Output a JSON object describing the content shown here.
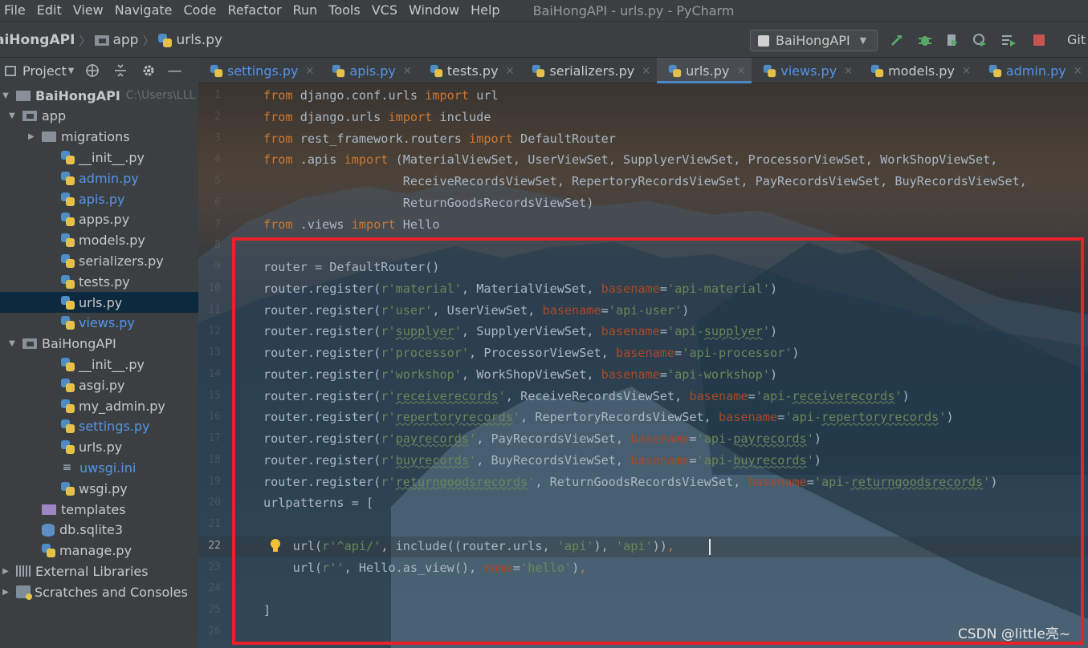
{
  "menu": [
    "File",
    "Edit",
    "View",
    "Navigate",
    "Code",
    "Refactor",
    "Run",
    "Tools",
    "VCS",
    "Window",
    "Help"
  ],
  "window_title": "BaiHongAPI - urls.py - PyCharm",
  "breadcrumb": [
    "aiHongAPI",
    "app",
    "urls.py"
  ],
  "toolbar": {
    "run_config": "BaiHongAPI",
    "git_label": "Git",
    "icons": [
      "hammer-icon",
      "bug-icon",
      "coverage-icon",
      "profile-icon",
      "concurrency-icon",
      "stop-icon"
    ]
  },
  "project_panel": {
    "title": "Project",
    "tree": [
      {
        "label": "BaiHongAPI",
        "hint": "C:\\Users\\LLL",
        "type": "folder",
        "indent": 0,
        "arrow": "down",
        "bold": true
      },
      {
        "label": "app",
        "type": "folder-open",
        "indent": 1,
        "arrow": "down"
      },
      {
        "label": "migrations",
        "type": "folder",
        "indent": 2,
        "arrow": "right"
      },
      {
        "label": "__init__.py",
        "type": "py",
        "indent": 3
      },
      {
        "label": "admin.py",
        "type": "py",
        "indent": 3,
        "blue": true
      },
      {
        "label": "apis.py",
        "type": "py",
        "indent": 3,
        "blue": true
      },
      {
        "label": "apps.py",
        "type": "py",
        "indent": 3
      },
      {
        "label": "models.py",
        "type": "py",
        "indent": 3
      },
      {
        "label": "serializers.py",
        "type": "py",
        "indent": 3
      },
      {
        "label": "tests.py",
        "type": "py",
        "indent": 3
      },
      {
        "label": "urls.py",
        "type": "py",
        "indent": 3,
        "selected": true
      },
      {
        "label": "views.py",
        "type": "py",
        "indent": 3,
        "blue": true
      },
      {
        "label": "BaiHongAPI",
        "type": "folder-open",
        "indent": 1,
        "arrow": "down"
      },
      {
        "label": "__init__.py",
        "type": "py",
        "indent": 3
      },
      {
        "label": "asgi.py",
        "type": "py",
        "indent": 3
      },
      {
        "label": "my_admin.py",
        "type": "py",
        "indent": 3
      },
      {
        "label": "settings.py",
        "type": "py",
        "indent": 3,
        "blue": true
      },
      {
        "label": "urls.py",
        "type": "py",
        "indent": 3
      },
      {
        "label": "uwsgi.ini",
        "type": "ini",
        "indent": 3,
        "blue": true
      },
      {
        "label": "wsgi.py",
        "type": "py",
        "indent": 3
      },
      {
        "label": "templates",
        "type": "folder-purple",
        "indent": 2
      },
      {
        "label": "db.sqlite3",
        "type": "db",
        "indent": 2
      },
      {
        "label": "manage.py",
        "type": "py",
        "indent": 2
      },
      {
        "label": "External Libraries",
        "type": "lib",
        "indent": 0,
        "arrow": "right"
      },
      {
        "label": "Scratches and Consoles",
        "type": "scratch",
        "indent": 0,
        "arrow": "right"
      }
    ]
  },
  "tabs": [
    {
      "label": "settings.py",
      "blue": true
    },
    {
      "label": "apis.py",
      "blue": true
    },
    {
      "label": "tests.py"
    },
    {
      "label": "serializers.py"
    },
    {
      "label": "urls.py",
      "active": true
    },
    {
      "label": "views.py",
      "blue": true
    },
    {
      "label": "models.py"
    },
    {
      "label": "admin.py",
      "blue": true
    }
  ],
  "editor": {
    "current_line": 22,
    "line_numbers": [
      "1",
      "2",
      "3",
      "4",
      "5",
      "6",
      "7",
      "8",
      "9",
      "10",
      "11",
      "12",
      "13",
      "14",
      "15",
      "16",
      "17",
      "18",
      "19",
      "20",
      "21",
      "22",
      "23",
      "24",
      "25",
      "26"
    ],
    "lines": [
      [
        [
          "kw",
          "from "
        ],
        [
          "",
          "django.conf.urls "
        ],
        [
          "kw",
          "import "
        ],
        [
          "",
          "url"
        ]
      ],
      [
        [
          "kw",
          "from "
        ],
        [
          "",
          "django.urls "
        ],
        [
          "kw",
          "import "
        ],
        [
          "",
          "include"
        ]
      ],
      [
        [
          "kw",
          "from "
        ],
        [
          "",
          "rest_framework.routers "
        ],
        [
          "kw",
          "import "
        ],
        [
          "",
          "DefaultRouter"
        ]
      ],
      [
        [
          "kw",
          "from "
        ],
        [
          "",
          ".apis "
        ],
        [
          "kw",
          "import "
        ],
        [
          "",
          "(MaterialViewSet, UserViewSet, SupplyerViewSet, ProcessorViewSet, WorkShopViewSet,"
        ]
      ],
      [
        [
          "",
          "                   ReceiveRecordsViewSet, RepertoryRecordsViewSet, PayRecordsViewSet, BuyRecordsViewSet,"
        ]
      ],
      [
        [
          "",
          "                   ReturnGoodsRecordsViewSet)"
        ]
      ],
      [
        [
          "kw",
          "from "
        ],
        [
          "",
          ".views "
        ],
        [
          "kw",
          "import "
        ],
        [
          "",
          "Hello"
        ]
      ],
      [],
      [
        [
          "",
          "router = DefaultRouter()"
        ]
      ],
      [
        [
          "",
          "router.register("
        ],
        [
          "st",
          "r'material'"
        ],
        [
          "",
          ", MaterialViewSet, "
        ],
        [
          "pn",
          "basename"
        ],
        [
          "",
          "="
        ],
        [
          "st",
          "'api-material'"
        ],
        [
          "",
          ")"
        ]
      ],
      [
        [
          "",
          "router.register("
        ],
        [
          "st",
          "r'user'"
        ],
        [
          "",
          ", UserViewSet, "
        ],
        [
          "pn",
          "basename"
        ],
        [
          "",
          "="
        ],
        [
          "st",
          "'api-user'"
        ],
        [
          "",
          ")"
        ]
      ],
      [
        [
          "",
          "router.register("
        ],
        [
          "st",
          "r'"
        ],
        [
          "sts",
          "supplyer"
        ],
        [
          "st",
          "'"
        ],
        [
          "",
          ", SupplyerViewSet, "
        ],
        [
          "pn",
          "basename"
        ],
        [
          "",
          "="
        ],
        [
          "st",
          "'api-"
        ],
        [
          "sts",
          "supplyer"
        ],
        [
          "st",
          "'"
        ],
        [
          "",
          ")"
        ]
      ],
      [
        [
          "",
          "router.register("
        ],
        [
          "st",
          "r'processor'"
        ],
        [
          "",
          ", ProcessorViewSet, "
        ],
        [
          "pn",
          "basename"
        ],
        [
          "",
          "="
        ],
        [
          "st",
          "'api-processor'"
        ],
        [
          "",
          ")"
        ]
      ],
      [
        [
          "",
          "router.register("
        ],
        [
          "st",
          "r'workshop'"
        ],
        [
          "",
          ", WorkShopViewSet, "
        ],
        [
          "pn",
          "basename"
        ],
        [
          "",
          "="
        ],
        [
          "st",
          "'api-workshop'"
        ],
        [
          "",
          ")"
        ]
      ],
      [
        [
          "",
          "router.register("
        ],
        [
          "st",
          "r'"
        ],
        [
          "sts",
          "receiverecords"
        ],
        [
          "st",
          "'"
        ],
        [
          "",
          ", ReceiveRecordsViewSet, "
        ],
        [
          "pn",
          "basename"
        ],
        [
          "",
          "="
        ],
        [
          "st",
          "'api-"
        ],
        [
          "sts",
          "receiverecords"
        ],
        [
          "st",
          "'"
        ],
        [
          "",
          ")"
        ]
      ],
      [
        [
          "",
          "router.register("
        ],
        [
          "st",
          "r'"
        ],
        [
          "sts",
          "repertoryrecords"
        ],
        [
          "st",
          "'"
        ],
        [
          "",
          ", RepertoryRecordsViewSet, "
        ],
        [
          "pn",
          "basename"
        ],
        [
          "",
          "="
        ],
        [
          "st",
          "'api-"
        ],
        [
          "sts",
          "repertoryrecords"
        ],
        [
          "st",
          "'"
        ],
        [
          "",
          ")"
        ]
      ],
      [
        [
          "",
          "router.register("
        ],
        [
          "st",
          "r'"
        ],
        [
          "sts",
          "payrecords"
        ],
        [
          "st",
          "'"
        ],
        [
          "",
          ", PayRecordsViewSet, "
        ],
        [
          "pn",
          "basename"
        ],
        [
          "",
          "="
        ],
        [
          "st",
          "'api-"
        ],
        [
          "sts",
          "payrecords"
        ],
        [
          "st",
          "'"
        ],
        [
          "",
          ")"
        ]
      ],
      [
        [
          "",
          "router.register("
        ],
        [
          "st",
          "r'"
        ],
        [
          "sts",
          "buyrecords"
        ],
        [
          "st",
          "'"
        ],
        [
          "",
          ", BuyRecordsViewSet, "
        ],
        [
          "pn",
          "basename"
        ],
        [
          "",
          "="
        ],
        [
          "st",
          "'api-"
        ],
        [
          "sts",
          "buyrecords"
        ],
        [
          "st",
          "'"
        ],
        [
          "",
          ")"
        ]
      ],
      [
        [
          "",
          "router.register("
        ],
        [
          "st",
          "r'"
        ],
        [
          "sts",
          "returngoodsrecords"
        ],
        [
          "st",
          "'"
        ],
        [
          "",
          ", ReturnGoodsRecordsViewSet, "
        ],
        [
          "pn",
          "basename"
        ],
        [
          "",
          "="
        ],
        [
          "st",
          "'api-"
        ],
        [
          "sts",
          "returngoodsrecords"
        ],
        [
          "st",
          "'"
        ],
        [
          "",
          ")"
        ]
      ],
      [
        [
          "",
          "urlpatterns = ["
        ]
      ],
      [],
      [
        [
          "",
          "    url("
        ],
        [
          "st",
          "r'^api/'"
        ],
        [
          "",
          ", include((router.urls, "
        ],
        [
          "st",
          "'api'"
        ],
        [
          "",
          "), "
        ],
        [
          "st",
          "'api'"
        ],
        [
          "",
          "))"
        ],
        [
          "kw",
          ","
        ]
      ],
      [
        [
          "",
          "    url("
        ],
        [
          "st",
          "r''"
        ],
        [
          "",
          ", Hello.as_view(), "
        ],
        [
          "pn",
          "name"
        ],
        [
          "",
          "="
        ],
        [
          "st",
          "'hello'"
        ],
        [
          "",
          ")"
        ],
        [
          "kw",
          ","
        ]
      ],
      [],
      [
        [
          "",
          "]"
        ]
      ],
      []
    ]
  },
  "watermark": "CSDN @little亮~",
  "colors": {
    "keyword": "#cc7832",
    "string": "#6a8759",
    "param": "#aa4926",
    "default": "#a9b7c6",
    "highlight": "#e8212a",
    "tab_underline": "#4a88c7",
    "vcs_blue": "#5494e8"
  }
}
